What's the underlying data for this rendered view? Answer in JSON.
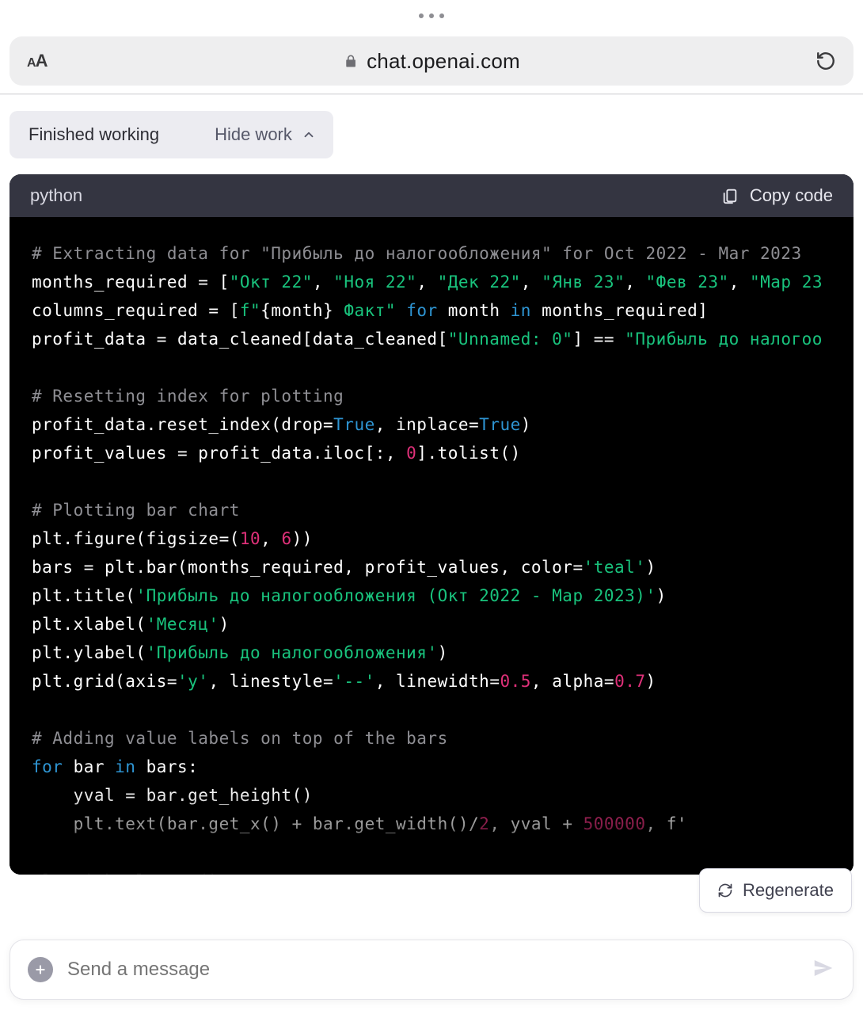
{
  "browser": {
    "url": "chat.openai.com"
  },
  "status": {
    "finished": "Finished working",
    "hide": "Hide work"
  },
  "code": {
    "lang": "python",
    "copy": "Copy code",
    "lines": [
      {
        "type": "comment",
        "text": "# Extracting data for \"Прибыль до налогообложения\" for Oct 2022 - Mar 2023"
      },
      {
        "type": "html",
        "text": "months_required = [<span class='s'>\"Окт 22\"</span>, <span class='s'>\"Ноя 22\"</span>, <span class='s'>\"Дек 22\"</span>, <span class='s'>\"Янв 23\"</span>, <span class='s'>\"Фев 23\"</span>, <span class='s'>\"Мар 23</span>"
      },
      {
        "type": "html",
        "text": "columns_required = [<span class='s'>f\"</span>{month}<span class='s'> Факт\"</span> <span class='k'>for</span> month <span class='k'>in</span> months_required]"
      },
      {
        "type": "html",
        "text": "profit_data = data_cleaned[data_cleaned[<span class='s'>\"Unnamed: 0\"</span>] == <span class='s'>\"Прибыль до налогоо</span>"
      },
      {
        "type": "blank",
        "text": ""
      },
      {
        "type": "comment",
        "text": "# Resetting index for plotting"
      },
      {
        "type": "html",
        "text": "profit_data.reset_index(drop=<span class='b'>True</span>, inplace=<span class='b'>True</span>)"
      },
      {
        "type": "html",
        "text": "profit_values = profit_data.iloc[:, <span class='n'>0</span>].tolist()"
      },
      {
        "type": "blank",
        "text": ""
      },
      {
        "type": "comment",
        "text": "# Plotting bar chart"
      },
      {
        "type": "html",
        "text": "plt.figure(figsize=(<span class='n'>10</span>, <span class='n'>6</span>))"
      },
      {
        "type": "html",
        "text": "bars = plt.bar(months_required, profit_values, color=<span class='s'>'teal'</span>)"
      },
      {
        "type": "html",
        "text": "plt.title(<span class='s'>'Прибыль до налогообложения (Окт 2022 - Мар 2023)'</span>)"
      },
      {
        "type": "html",
        "text": "plt.xlabel(<span class='s'>'Месяц'</span>)"
      },
      {
        "type": "html",
        "text": "plt.ylabel(<span class='s'>'Прибыль до налогообложения'</span>)"
      },
      {
        "type": "html",
        "text": "plt.grid(axis=<span class='s'>'y'</span>, linestyle=<span class='s'>'--'</span>, linewidth=<span class='n'>0.5</span>, alpha=<span class='n'>0.7</span>)"
      },
      {
        "type": "blank",
        "text": ""
      },
      {
        "type": "comment",
        "text": "# Adding value labels on top of the bars"
      },
      {
        "type": "html",
        "text": "<span class='k'>for</span> bar <span class='k'>in</span> bars:"
      },
      {
        "type": "html",
        "text": "    yval = bar.get_height()"
      },
      {
        "type": "html",
        "text": "    plt.text(bar.get_x() + bar.get_width()/<span class='n'>2</span>, yval + <span class='n'>500000</span>, f'"
      },
      {
        "type": "blank",
        "text": ""
      },
      {
        "type": "plain",
        "text": "plt.tight_layout()"
      }
    ]
  },
  "regen": "Regenerate",
  "composer": {
    "placeholder": "Send a message"
  }
}
